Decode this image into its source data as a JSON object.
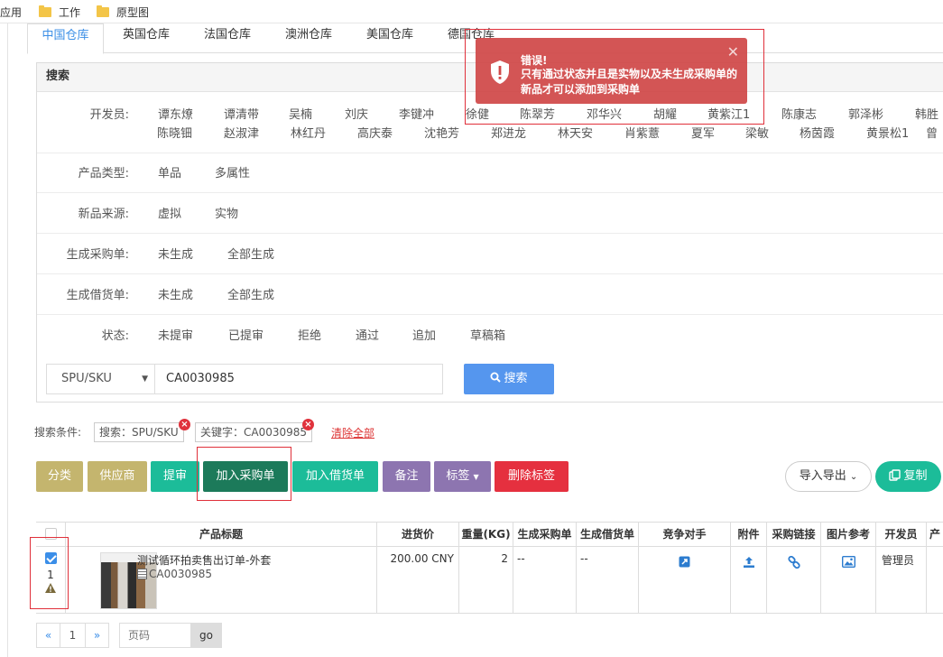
{
  "bookmarks": {
    "apps": "应用",
    "items": [
      "工作",
      "原型图"
    ]
  },
  "tabs": [
    "中国仓库",
    "英国仓库",
    "法国仓库",
    "澳洲仓库",
    "美国仓库",
    "德国仓库"
  ],
  "search_panel": {
    "title": "搜索",
    "developers_label": "开发员:",
    "developers_row1": [
      "谭东燎",
      "谭清带",
      "吴楠",
      "刘庆",
      "李键冲",
      "徐健",
      "陈翠芳",
      "邓华兴",
      "胡耀",
      "黄紫江1",
      "陈康志",
      "郭泽彬",
      "韩胜"
    ],
    "developers_row2": [
      "陈晓钿",
      "赵淑津",
      "林红丹",
      "高庆泰",
      "沈艳芳",
      "郑进龙",
      "林天安",
      "肖紫薏",
      "夏军",
      "梁敏",
      "杨茵霞",
      "黄景松1",
      "曾"
    ],
    "product_type_label": "产品类型:",
    "product_types": [
      "单品",
      "多属性"
    ],
    "source_label": "新品来源:",
    "sources": [
      "虚拟",
      "实物"
    ],
    "purchase_label": "生成采购单:",
    "purchase_opts": [
      "未生成",
      "全部生成"
    ],
    "loan_label": "生成借货单:",
    "loan_opts": [
      "未生成",
      "全部生成"
    ],
    "status_label": "状态:",
    "status_opts": [
      "未提审",
      "已提审",
      "拒绝",
      "通过",
      "追加",
      "草稿箱"
    ],
    "select_value": "SPU/SKU",
    "keyword_value": "CA0030985",
    "search_button": "搜索"
  },
  "conditions": {
    "label": "搜索条件:",
    "tags": [
      "搜索：SPU/SKU",
      "关键字：CA0030985"
    ],
    "clear_all": "清除全部"
  },
  "actions": {
    "classify": "分类",
    "supplier": "供应商",
    "submit": "提审",
    "add_purchase": "加入采购单",
    "add_loan": "加入借货单",
    "remark": "备注",
    "tag": "标签",
    "delete_tag": "删除标签",
    "import_export": "导入导出",
    "copy": "复制"
  },
  "table": {
    "headers": [
      "产品标题",
      "进货价",
      "重量(KG)",
      "生成采购单",
      "生成借货单",
      "竞争对手",
      "附件",
      "采购链接",
      "图片参考",
      "开发员",
      "产"
    ],
    "rows": [
      {
        "index": "1",
        "title": "测试循环拍卖售出订单-外套",
        "sku": "CA0030985",
        "price": "200.00 CNY",
        "weight": "2",
        "purchase": "--",
        "loan": "--",
        "developer": "管理员"
      }
    ]
  },
  "pagination": {
    "prev": "«",
    "page": "1",
    "next": "»",
    "placeholder": "页码",
    "go": "go"
  },
  "toast": {
    "title": "错误!",
    "message": "只有通过状态并且是实物以及未生成采购单的新品才可以添加到采购单",
    "color": "#d04848"
  }
}
